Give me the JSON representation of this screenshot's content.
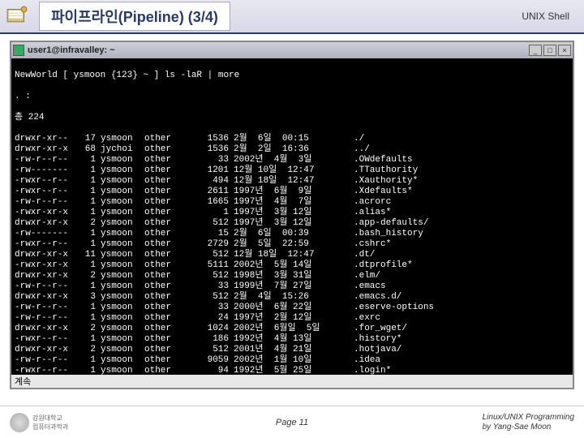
{
  "header": {
    "title": "파이프라인(Pipeline) (3/4)",
    "right_label": "UNIX Shell"
  },
  "terminal": {
    "window_title": "user1@infravalley: ~",
    "btn_min": "_",
    "btn_max": "□",
    "btn_close": "×",
    "prompt_line": "NewWorld [ ysmoon {123} ~ ] ls -laR | more",
    "dot_line": ". :",
    "total_line": "총 224",
    "more_label": "계속",
    "rows": [
      {
        "perm": "drwxr-xr--",
        "ln": "17",
        "own": "ysmoon",
        "grp": "other",
        "sz": "1536",
        "dt": "2월  6일  00:15",
        "nm": "./"
      },
      {
        "perm": "drwxr-xr-x",
        "ln": "68",
        "own": "jychoi",
        "grp": "other",
        "sz": "1536",
        "dt": "2월  2일  16:36",
        "nm": "../"
      },
      {
        "perm": "-rw-r--r--",
        "ln": "1",
        "own": "ysmoon",
        "grp": "other",
        "sz": "33",
        "dt": "2002년  4월  3일",
        "nm": ".OWdefaults"
      },
      {
        "perm": "-rw-------",
        "ln": "1",
        "own": "ysmoon",
        "grp": "other",
        "sz": "1201",
        "dt": "12월 10일  12:47",
        "nm": ".TTauthority"
      },
      {
        "perm": "-rwxr--r--",
        "ln": "1",
        "own": "ysmoon",
        "grp": "other",
        "sz": "494",
        "dt": "12월 18일  12:47",
        "nm": ".Xauthority*"
      },
      {
        "perm": "-rwxr--r--",
        "ln": "1",
        "own": "ysmoon",
        "grp": "other",
        "sz": "2611",
        "dt": "1997년  6월  9일",
        "nm": ".Xdefaults*"
      },
      {
        "perm": "-rw-r--r--",
        "ln": "1",
        "own": "ysmoon",
        "grp": "other",
        "sz": "1665",
        "dt": "1997년  4월  7일",
        "nm": ".acrorc"
      },
      {
        "perm": "-rwxr-xr-x",
        "ln": "1",
        "own": "ysmoon",
        "grp": "other",
        "sz": "1",
        "dt": "1997년  3월 12일",
        "nm": ".alias*"
      },
      {
        "perm": "drwxr-xr-x",
        "ln": "2",
        "own": "ysmoon",
        "grp": "other",
        "sz": "512",
        "dt": "1997년  3월 12일",
        "nm": ".app-defaults/"
      },
      {
        "perm": "-rw-------",
        "ln": "1",
        "own": "ysmoon",
        "grp": "other",
        "sz": "15",
        "dt": "2월  6일  00:39",
        "nm": ".bash_history"
      },
      {
        "perm": "-rwxr--r--",
        "ln": "1",
        "own": "ysmoon",
        "grp": "other",
        "sz": "2729",
        "dt": "2월  5일  22:59",
        "nm": ".cshrc*"
      },
      {
        "perm": "drwxr-xr-x",
        "ln": "11",
        "own": "ysmoon",
        "grp": "other",
        "sz": "512",
        "dt": "12월 18일  12:47",
        "nm": ".dt/"
      },
      {
        "perm": "-rwxr-xr-x",
        "ln": "1",
        "own": "ysmoon",
        "grp": "other",
        "sz": "5111",
        "dt": "2002년  5월 14일",
        "nm": ".dtprofile*"
      },
      {
        "perm": "drwxr-xr-x",
        "ln": "2",
        "own": "ysmoon",
        "grp": "other",
        "sz": "512",
        "dt": "1998년  3월 31일",
        "nm": ".elm/"
      },
      {
        "perm": "-rw-r--r--",
        "ln": "1",
        "own": "ysmoon",
        "grp": "other",
        "sz": "33",
        "dt": "1999년  7월 27일",
        "nm": ".emacs"
      },
      {
        "perm": "drwxr-xr-x",
        "ln": "3",
        "own": "ysmoon",
        "grp": "other",
        "sz": "512",
        "dt": "2월  4일  15:26",
        "nm": ".emacs.d/"
      },
      {
        "perm": "-rw-r--r--",
        "ln": "1",
        "own": "ysmoon",
        "grp": "other",
        "sz": "33",
        "dt": "2000년  6월 22일",
        "nm": ".eserve-options"
      },
      {
        "perm": "-rw-r--r--",
        "ln": "1",
        "own": "ysmoon",
        "grp": "other",
        "sz": "24",
        "dt": "1997년  2월 12일",
        "nm": ".exrc"
      },
      {
        "perm": "drwxr-xr-x",
        "ln": "2",
        "own": "ysmoon",
        "grp": "other",
        "sz": "1024",
        "dt": "2002년  6월일  5일",
        "nm": ".for_wget/"
      },
      {
        "perm": "-rwxr--r--",
        "ln": "1",
        "own": "ysmoon",
        "grp": "other",
        "sz": "186",
        "dt": "1992년  4월 13일",
        "nm": ".history*"
      },
      {
        "perm": "drwxr-xr-x",
        "ln": "2",
        "own": "ysmoon",
        "grp": "other",
        "sz": "512",
        "dt": "2001년  4월 21일",
        "nm": ".hotjava/"
      },
      {
        "perm": "-rw-r--r--",
        "ln": "1",
        "own": "ysmoon",
        "grp": "other",
        "sz": "9059",
        "dt": "2002년  1월 10일",
        "nm": ".idea"
      },
      {
        "perm": "-rwxr--r--",
        "ln": "1",
        "own": "ysmoon",
        "grp": "other",
        "sz": "94",
        "dt": "1992년  5월 25일",
        "nm": ".login*"
      }
    ]
  },
  "footer": {
    "logo_text": "강원대학교\n컴퓨터과학과",
    "page": "Page 11",
    "credit_line1": "Linux/UNIX Programming",
    "credit_line2": "by Yang-Sae Moon"
  }
}
